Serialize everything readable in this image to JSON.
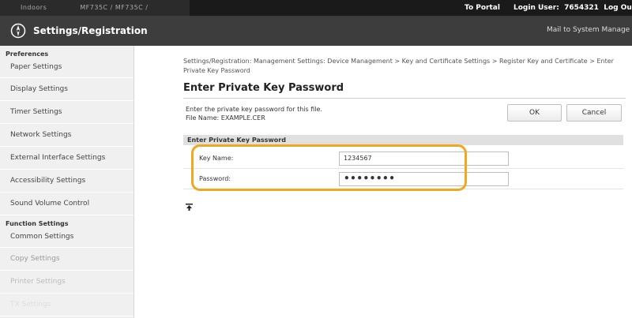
{
  "topbar": {
    "device_name": "Indoors",
    "device_address": "MF735C / MF735C /",
    "portal": "To Portal",
    "login_user": "Login User:",
    "user_id": "7654321",
    "logout": "Log Ou"
  },
  "header": {
    "logo_icon": "compass-logo-icon",
    "title": "Settings/Registration",
    "mail_link": "Mail to System Manage"
  },
  "sidebar": {
    "preferences_title": "Preferences",
    "preferences_items": [
      "Paper Settings",
      "Display Settings",
      "Timer Settings",
      "Network Settings",
      "External Interface Settings",
      "Accessibility Settings",
      "Sound Volume Control"
    ],
    "function_title": "Function Settings",
    "function_items": [
      "Common Settings",
      "Copy Settings",
      "Printer Settings",
      "TX Settings"
    ]
  },
  "main": {
    "breadcrumb": "Settings/Registration: Management Settings: Device Management > Key and Certificate Settings > Register Key and Certificate > Enter Private Key Password",
    "page_title": "Enter Private Key Password",
    "description": "Enter the private key password for this file.",
    "file_name": "File Name: EXAMPLE.CER",
    "ok_label": "OK",
    "cancel_label": "Cancel",
    "section_title": "Enter Private Key Password",
    "key_name_label": "Key Name:",
    "key_name_value": "1234567",
    "password_label": "Password:",
    "password_value": "••••••••",
    "top_icon": "go-to-top-icon"
  },
  "colors": {
    "highlight": "#f0a81e",
    "header_bg": "#3d3d3d",
    "topbar_bg": "#1a1a1a",
    "sidebar_bg": "#f0f0f0"
  }
}
